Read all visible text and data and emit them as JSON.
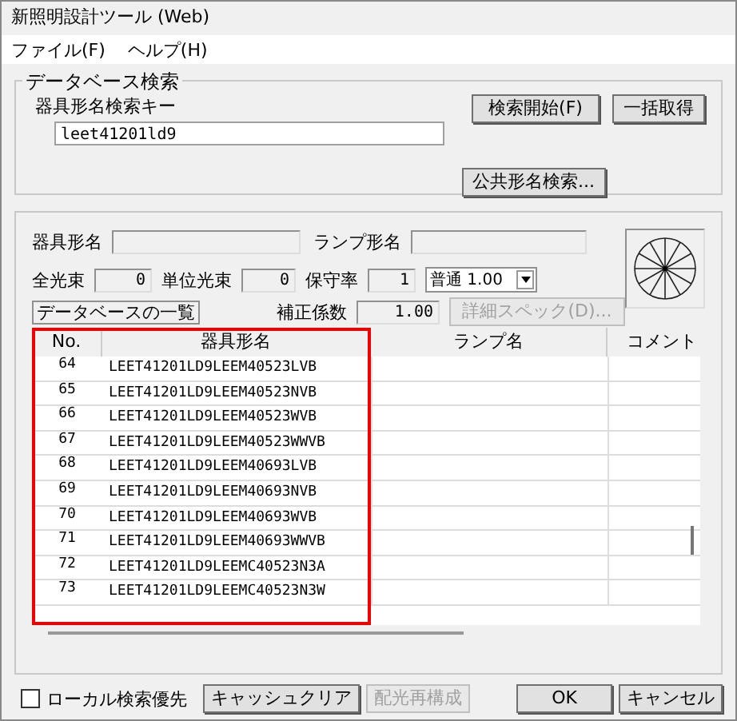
{
  "window": {
    "title": "新照明設計ツール (Web)"
  },
  "menu": [
    "ファイル(F)",
    "ヘルプ(H)"
  ],
  "search_group": {
    "title": "データベース検索",
    "key_label": "器具形名検索キー",
    "key_value": "leet41201ld9",
    "buttons": [
      "検索開始(F)",
      "一括取得"
    ],
    "public_search_button": "公共形名検索..."
  },
  "details": {
    "fixture_label": "器具形名",
    "lamp_label": "ランプ形名",
    "total_flux_label": "全光束",
    "total_flux": "0",
    "unit_flux_label": "単位光束",
    "unit_flux": "0",
    "maintenance_label": "保守率",
    "maintenance": "1",
    "maintenance_select": "普通 1.00",
    "list_label": "データベースの一覧",
    "correction_label": "補正係数",
    "correction": "1.00",
    "spec_button": {
      "label": "詳細スペック(D)...",
      "disabled": true
    }
  },
  "table": {
    "columns": [
      "No.",
      "器具形名",
      "ランプ名",
      "コメント"
    ],
    "rows": [
      {
        "no": "64",
        "name": "LEET41201LD9LEEM40523LVB"
      },
      {
        "no": "65",
        "name": "LEET41201LD9LEEM40523NVB"
      },
      {
        "no": "66",
        "name": "LEET41201LD9LEEM40523WVB"
      },
      {
        "no": "67",
        "name": "LEET41201LD9LEEM40523WWVB"
      },
      {
        "no": "68",
        "name": "LEET41201LD9LEEM40693LVB"
      },
      {
        "no": "69",
        "name": "LEET41201LD9LEEM40693NVB"
      },
      {
        "no": "70",
        "name": "LEET41201LD9LEEM40693WVB"
      },
      {
        "no": "71",
        "name": "LEET41201LD9LEEM40693WWVB"
      },
      {
        "no": "72",
        "name": "LEET41201LD9LEEMC40523N3A"
      },
      {
        "no": "73",
        "name": "LEET41201LD9LEEMC40523N3W"
      }
    ]
  },
  "footer": {
    "local_checkbox": {
      "label": "ローカル検索優先",
      "checked": false
    },
    "left_buttons": [
      {
        "label": "キャッシュクリア",
        "disabled": false
      },
      {
        "label": "配光再構成",
        "disabled": true
      }
    ],
    "right_buttons": [
      {
        "label": "OK",
        "disabled": false
      },
      {
        "label": "キャンセル",
        "disabled": false
      }
    ]
  }
}
